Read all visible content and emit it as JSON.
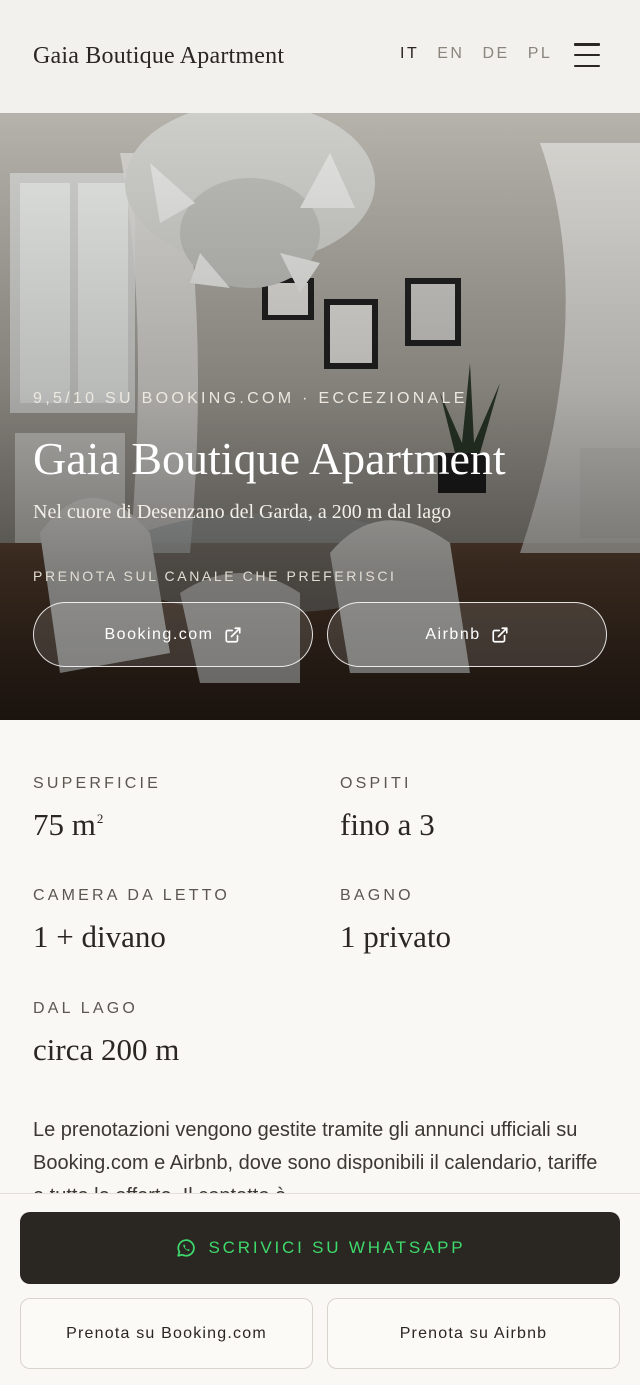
{
  "header": {
    "brand": "Gaia Boutique Apartment",
    "languages": [
      {
        "code": "IT",
        "active": true
      },
      {
        "code": "EN",
        "active": false
      },
      {
        "code": "DE",
        "active": false
      },
      {
        "code": "PL",
        "active": false
      }
    ],
    "menu_icon": "hamburger-menu-icon"
  },
  "hero": {
    "rating": "9,5/10 SU BOOKING.COM · ECCEZIONALE",
    "title": "Gaia Boutique Apartment",
    "subtitle": "Nel cuore di Desenzano del Garda, a 200 m dal lago",
    "channel_label": "PRENOTA SUL CANALE CHE PREFERISCI",
    "buttons": [
      {
        "label": "Booking.com",
        "icon": "external-link-icon"
      },
      {
        "label": "Airbnb",
        "icon": "external-link-icon"
      }
    ]
  },
  "stats": [
    {
      "label": "SUPERFICIE",
      "value": "75 m",
      "sup": "2"
    },
    {
      "label": "OSPITI",
      "value": "fino a 3"
    },
    {
      "label": "CAMERA DA LETTO",
      "value": "1 + divano"
    },
    {
      "label": "BAGNO",
      "value": "1 privato"
    },
    {
      "label": "DAL LAGO",
      "value": "circa 200 m"
    }
  ],
  "description": "Le prenotazioni vengono gestite tramite gli annunci ufficiali su Booking.com e Airbnb, dove sono disponibili il calendario, tariffe e tutte le offerte. Il contatto è",
  "bottom_bar": {
    "whatsapp_label": "SCRIVICI SU WHATSAPP",
    "whatsapp_icon": "whatsapp-icon",
    "whatsapp_color": "#3ed96b",
    "booking_label": "Prenota su Booking.com",
    "airbnb_label": "Prenota su Airbnb"
  },
  "colors": {
    "dark": "#2a2622",
    "background": "#f9f8f4"
  }
}
